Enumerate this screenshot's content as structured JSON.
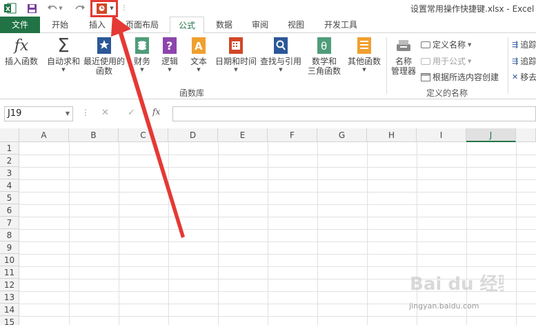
{
  "window": {
    "title": "设置常用操作快捷键.xlsx - Excel"
  },
  "quick_access": [
    "excel-logo-icon",
    "save-icon",
    "undo-icon",
    "redo-icon",
    "custom-macro-icon"
  ],
  "tabs": [
    {
      "label": "文件",
      "kind": "file"
    },
    {
      "label": "开始"
    },
    {
      "label": "插入"
    },
    {
      "label": "页面布局"
    },
    {
      "label": "公式",
      "active": true
    },
    {
      "label": "数据"
    },
    {
      "label": "审阅"
    },
    {
      "label": "视图"
    },
    {
      "label": "开发工具"
    }
  ],
  "ribbon": {
    "insert_function": "插入函数",
    "autosum": "自动求和",
    "recent_line1": "最近使用的",
    "recent_line2": "函数",
    "financial": "财务",
    "logical": "逻辑",
    "text": "文本",
    "datetime": "日期和时间",
    "lookup": "查找与引用",
    "math_line1": "数学和",
    "math_line2": "三角函数",
    "more": "其他函数",
    "group_function_library": "函数库",
    "name_manager_line1": "名称",
    "name_manager_line2": "管理器",
    "define_name": "定义名称",
    "use_in_formula": "用于公式",
    "create_from_selection": "根据所选内容创建",
    "group_defined_names": "定义的名称",
    "trace1": "追踪",
    "trace2": "追踪",
    "remove": "移去"
  },
  "formula_bar": {
    "name_box": "J19",
    "cancel": "✕",
    "enter": "✓",
    "fx": "fx"
  },
  "columns": [
    "A",
    "B",
    "C",
    "D",
    "E",
    "F",
    "G",
    "H",
    "I",
    "J"
  ],
  "selected_column": "J",
  "rows": [
    "1",
    "2",
    "3",
    "4",
    "5",
    "6",
    "7",
    "8",
    "9",
    "10",
    "11",
    "12",
    "13",
    "14",
    "15"
  ],
  "watermark": {
    "brand": "Bai du 经验",
    "url": "jingyan.baidu.com"
  },
  "colors": {
    "excel_green": "#217346",
    "annotation_red": "#e53935"
  }
}
